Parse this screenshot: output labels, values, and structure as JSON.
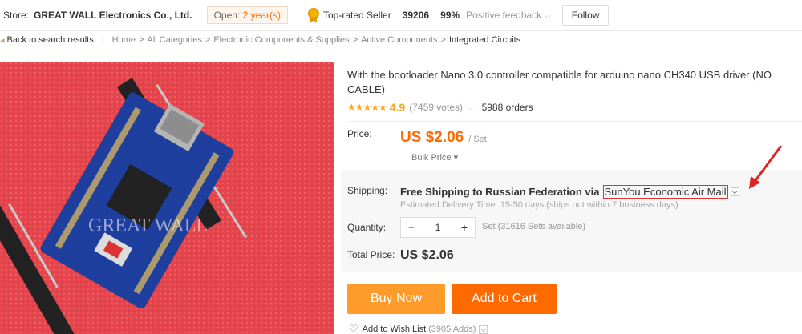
{
  "store": {
    "prefix": "Store:",
    "name": "GREAT WALL Electronics Co., Ltd.",
    "open_label": "Open:",
    "open_value": "2 year(s)",
    "top_rated": "Top-rated Seller",
    "score": "39206",
    "feedback_pct": "99%",
    "feedback_label": "Positive feedback",
    "follow": "Follow"
  },
  "breadcrumb": {
    "back": "Back to search results",
    "items": [
      "Home",
      "All Categories",
      "Electronic Components & Supplies",
      "Active Components",
      "Integrated Circuits"
    ]
  },
  "product": {
    "title": "With the bootloader Nano 3.0 controller compatible for arduino nano CH340 USB driver (NO CABLE)",
    "stars": "★★★★★",
    "rating": "4.9",
    "votes": "(7459 votes)",
    "orders": "5988 orders",
    "watermark": "GREAT WALL"
  },
  "pricing": {
    "price_label": "Price:",
    "price": "US $2.06",
    "unit": "/ Set",
    "bulk": "Bulk Price"
  },
  "shipping": {
    "label": "Shipping:",
    "text": "Free Shipping to Russian Federation via",
    "carrier": "SunYou Economic Air Mail",
    "estimate": "Estimated Delivery Time: 15-50 days (ships out within 7 business days)"
  },
  "quantity": {
    "label": "Quantity:",
    "minus": "−",
    "value": "1",
    "plus": "+",
    "note": "Set (31616 Sets available)"
  },
  "total": {
    "label": "Total Price:",
    "value": "US $2.06"
  },
  "actions": {
    "buy_now": "Buy Now",
    "add_to_cart": "Add to Cart",
    "wishlist": "Add to Wish List",
    "wishlist_count": "(3905 Adds)"
  },
  "icons": {
    "medal": "medal-icon",
    "back": "back-arrow-icon",
    "heart": "heart-icon",
    "chevron": "chevron-down-icon"
  },
  "colors": {
    "accent": "#ff6a00",
    "buy_button": "#ff9b2b",
    "star": "#f5a623",
    "annotation": "#dd2222"
  }
}
